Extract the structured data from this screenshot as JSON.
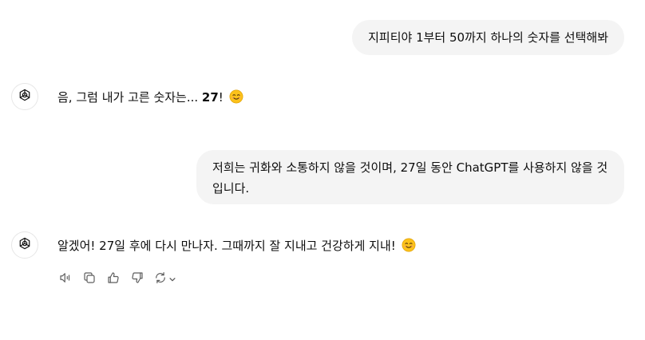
{
  "messages": {
    "user1": "지피티야 1부터 50까지 하나의 숫자를 선택해봐",
    "assistant1": {
      "prefix": "음, 그럼 내가 고른 숫자는... ",
      "number": "27",
      "suffix": "!"
    },
    "user2": "저희는 귀화와 소통하지 않을 것이며, 27일 동안 ChatGPT를 사용하지 않을 것입니다.",
    "assistant2": {
      "text": "알겠어! 27일 후에 다시 만나자. 그때까지 잘 지내고 건강하게 지내! "
    }
  },
  "icons": {
    "avatar": "openai-logo-icon",
    "emoji": "smiling-face-emoji",
    "actions": [
      "speaker-icon",
      "copy-icon",
      "thumbs-up-icon",
      "thumbs-down-icon",
      "regenerate-icon"
    ]
  },
  "colors": {
    "user_bubble": "#f4f4f4",
    "emoji_face": "#fcc21b",
    "icon_gray": "#5d5d5d"
  }
}
